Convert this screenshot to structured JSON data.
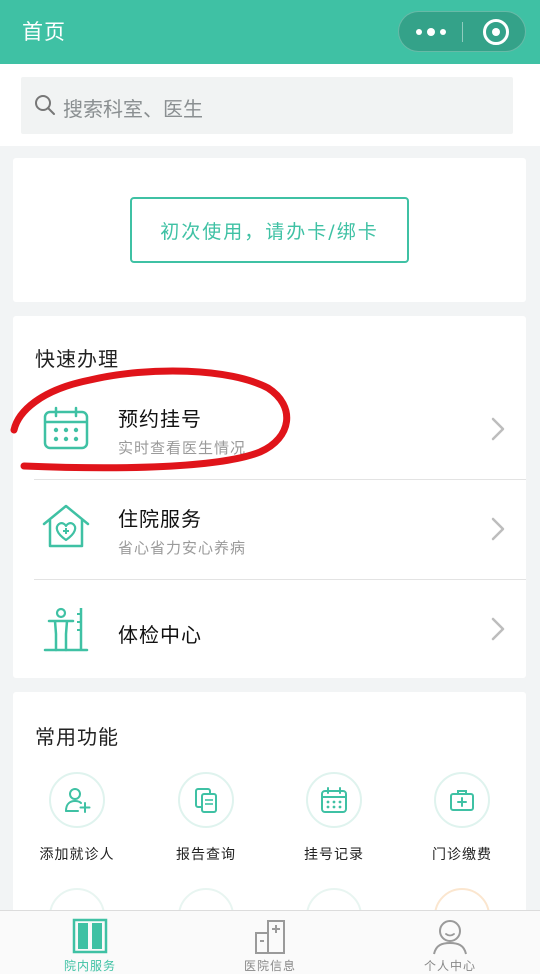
{
  "nav": {
    "title": "首页"
  },
  "search": {
    "placeholder": "搜索科室、医生"
  },
  "bind_card": {
    "label": "初次使用，请办卡/绑卡"
  },
  "quick": {
    "title": "快速办理",
    "items": [
      {
        "title": "预约挂号",
        "subtitle": "实时查看医生情况",
        "icon": "calendar-icon"
      },
      {
        "title": "住院服务",
        "subtitle": "省心省力安心养病",
        "icon": "hospital-house-icon"
      },
      {
        "title": "体检中心",
        "subtitle": "",
        "icon": "body-check-icon"
      }
    ]
  },
  "common": {
    "title": "常用功能",
    "items": [
      {
        "label": "添加就诊人",
        "icon": "add-user-icon"
      },
      {
        "label": "报告查询",
        "icon": "report-icon"
      },
      {
        "label": "挂号记录",
        "icon": "calendar-icon"
      },
      {
        "label": "门诊缴费",
        "icon": "medkit-icon"
      }
    ]
  },
  "tabbar": {
    "items": [
      {
        "label": "院内服务",
        "icon": "door-icon",
        "active": true
      },
      {
        "label": "医院信息",
        "icon": "building-icon",
        "active": false
      },
      {
        "label": "个人中心",
        "icon": "person-icon",
        "active": false
      }
    ]
  },
  "colors": {
    "accent": "#3fc1a4",
    "annotation": "#e0141a"
  }
}
